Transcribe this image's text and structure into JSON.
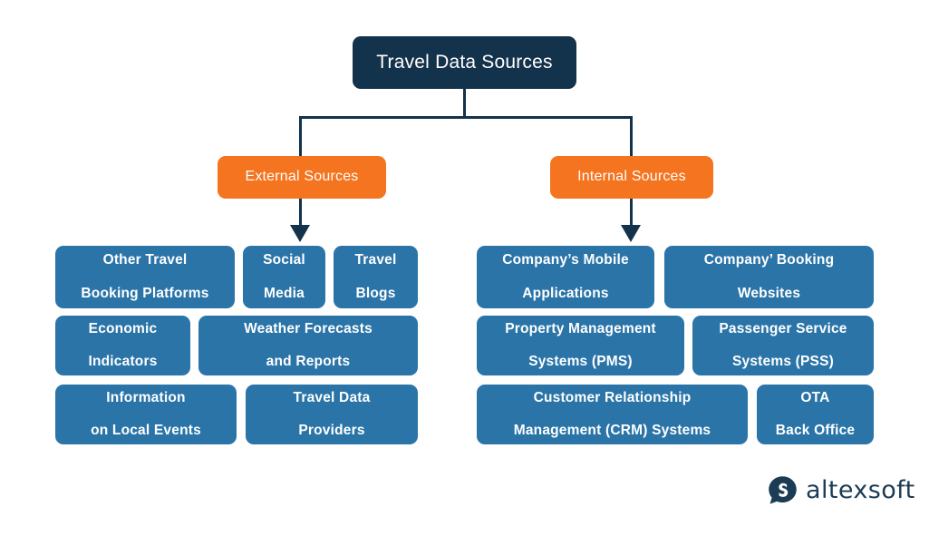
{
  "diagram": {
    "title": "Travel Data Sources",
    "colors": {
      "root": "#13324b",
      "branch": "#f5741f",
      "leaf": "#2a74a8",
      "connector": "#13324b",
      "background": "#ffffff",
      "logo": "#1c3c55"
    },
    "root": {
      "label": "Travel Data Sources"
    },
    "branches": [
      {
        "id": "external",
        "label": "External Sources",
        "leaves": [
          {
            "label": "Other Travel\nBooking Platforms",
            "line1": "Other Travel",
            "line2": "Booking Platforms"
          },
          {
            "label": "Social\nMedia",
            "line1": "Social",
            "line2": "Media"
          },
          {
            "label": "Travel\nBlogs",
            "line1": "Travel",
            "line2": "Blogs"
          },
          {
            "label": "Economic\nIndicators",
            "line1": "Economic",
            "line2": "Indicators"
          },
          {
            "label": "Weather Forecasts\nand Reports",
            "line1": "Weather Forecasts",
            "line2": "and Reports"
          },
          {
            "label": "Information\non Local Events",
            "line1": "Information",
            "line2": "on Local Events"
          },
          {
            "label": "Travel Data\nProviders",
            "line1": "Travel Data",
            "line2": "Providers"
          }
        ]
      },
      {
        "id": "internal",
        "label": "Internal Sources",
        "leaves": [
          {
            "label": "Company's Mobile\nApplications",
            "line1": "Company’s Mobile",
            "line2": "Applications"
          },
          {
            "label": "Company' Booking\nWebsites",
            "line1": "Company’ Booking",
            "line2": "Websites"
          },
          {
            "label": "Property Management\nSystems (PMS)",
            "line1": "Property Management",
            "line2": "Systems (PMS)"
          },
          {
            "label": "Passenger Service\nSystems (PSS)",
            "line1": "Passenger Service",
            "line2": "Systems (PSS)"
          },
          {
            "label": "Customer Relationship\nManagement (CRM) Systems",
            "line1": "Customer Relationship",
            "line2": "Management (CRM) Systems"
          },
          {
            "label": "OTA\nBack Office",
            "line1": "OTA",
            "line2": "Back Office"
          }
        ]
      }
    ]
  },
  "logo": {
    "brand": "altexsoft",
    "mark": "speech-bubble-icon"
  }
}
